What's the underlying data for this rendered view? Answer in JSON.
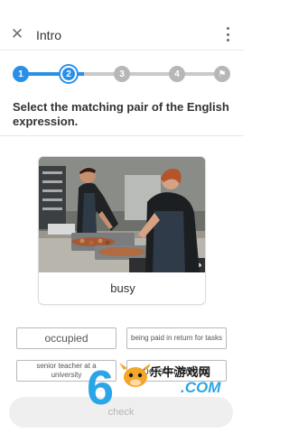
{
  "header": {
    "title": "Intro",
    "close_icon": "close-icon",
    "menu_icon": "more-vert-icon"
  },
  "progress": {
    "steps": [
      {
        "label": "1",
        "state": "done"
      },
      {
        "label": "2",
        "state": "current"
      },
      {
        "label": "3",
        "state": "todo"
      },
      {
        "label": "4",
        "state": "todo"
      },
      {
        "label": "",
        "state": "finish",
        "icon": "flag-icon"
      }
    ],
    "accent": "#2a8fe6",
    "inactive": "#b7b7b7"
  },
  "question": {
    "instruction": "Select the matching pair of the English expression."
  },
  "card": {
    "word": "busy",
    "image": "two chefs working in a kitchen"
  },
  "options": [
    {
      "label": "occupied"
    },
    {
      "label": "being paid in return for tasks"
    },
    {
      "label": "senior teacher at a university"
    },
    {
      "label": "person talking"
    }
  ],
  "actions": {
    "check_label": "check"
  },
  "watermark": {
    "cn_text": "乐牛游戏网",
    "com_text": ".COM"
  }
}
